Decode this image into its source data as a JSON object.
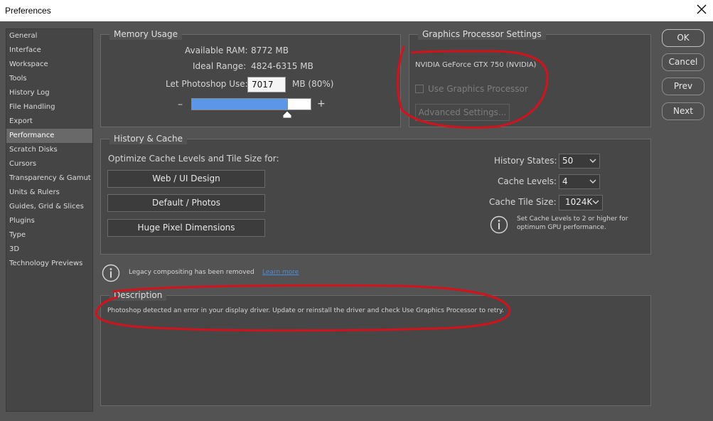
{
  "window": {
    "title": "Preferences"
  },
  "sidebar": {
    "items": [
      {
        "label": "General"
      },
      {
        "label": "Interface"
      },
      {
        "label": "Workspace"
      },
      {
        "label": "Tools"
      },
      {
        "label": "History Log"
      },
      {
        "label": "File Handling"
      },
      {
        "label": "Export"
      },
      {
        "label": "Performance"
      },
      {
        "label": "Scratch Disks"
      },
      {
        "label": "Cursors"
      },
      {
        "label": "Transparency & Gamut"
      },
      {
        "label": "Units & Rulers"
      },
      {
        "label": "Guides, Grid & Slices"
      },
      {
        "label": "Plugins"
      },
      {
        "label": "Type"
      },
      {
        "label": "3D"
      },
      {
        "label": "Technology Previews"
      }
    ],
    "active": "Performance"
  },
  "memory": {
    "title": "Memory Usage",
    "available_label": "Available RAM:",
    "available_value": "8772 MB",
    "ideal_label": "Ideal Range:",
    "ideal_value": "4824-6315 MB",
    "use_label": "Let Photoshop Use:",
    "use_value": "7017",
    "use_unit": "MB (80%)",
    "minus": "–",
    "plus": "+",
    "slider_fraction": 0.8
  },
  "gpu": {
    "title": "Graphics Processor Settings",
    "device": "NVIDIA GeForce GTX 750 (NVIDIA)",
    "use_gpu_label": "Use Graphics Processor",
    "use_gpu_checked": false,
    "advanced_label": "Advanced Settings..."
  },
  "actions": {
    "ok": "OK",
    "cancel": "Cancel",
    "prev": "Prev",
    "next": "Next"
  },
  "history_cache": {
    "title": "History & Cache",
    "optimize_label": "Optimize Cache Levels and Tile Size for:",
    "presets": [
      "Web / UI Design",
      "Default / Photos",
      "Huge Pixel Dimensions"
    ],
    "history_states_label": "History States:",
    "history_states_value": "50",
    "cache_levels_label": "Cache Levels:",
    "cache_levels_value": "4",
    "tile_size_label": "Cache Tile Size:",
    "tile_size_value": "1024K",
    "tip_line1": "Set Cache Levels to 2 or higher for",
    "tip_line2": "optimum GPU performance."
  },
  "legacy": {
    "message": "Legacy compositing has been removed",
    "link": "Learn more"
  },
  "description": {
    "title": "Description",
    "text": "Photoshop detected an error in your display driver. Update or reinstall the driver and check Use Graphics Processor to retry."
  },
  "icons": {
    "close": "close-icon",
    "chevron": "chevron-down-icon",
    "info": "info-icon",
    "checkbox": "checkbox-icon"
  },
  "colors": {
    "panel_bg": "#535353",
    "slider_fill": "#5b96e8",
    "link": "#4f8cd7",
    "annotation": "#d4121c"
  }
}
